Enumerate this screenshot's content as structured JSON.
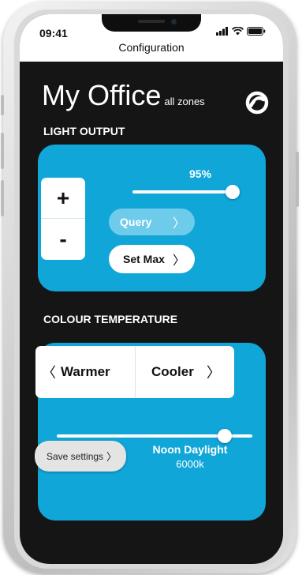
{
  "status_bar": {
    "time": "09:41",
    "page_title": "Configuration"
  },
  "header": {
    "title": "My Office",
    "subtitle": "all zones"
  },
  "light_output": {
    "section_label": "LIGHT OUTPUT",
    "level_label": "95%",
    "level_fraction": 0.95,
    "plus_label": "+",
    "minus_label": "-",
    "query_label": "Query",
    "set_max_label": "Set Max",
    "query_enabled": false
  },
  "colour_temperature": {
    "section_label": "COLOUR TEMPERATURE",
    "warmer_label": "Warmer",
    "cooler_label": "Cooler",
    "preset_name": "Noon Daylight",
    "preset_value": "6000k",
    "save_label": "Save settings",
    "slider_fraction": 0.86
  },
  "icons": {
    "signal": "cellular-signal-icon",
    "wifi": "wifi-icon",
    "battery": "battery-icon",
    "logo": "brand-logo-icon",
    "chevron_right": "chevron-right-icon",
    "chevron_left": "chevron-left-icon"
  },
  "colors": {
    "card": "#11a6d8",
    "query_disabled": "#6fcbea",
    "background": "#151515"
  }
}
